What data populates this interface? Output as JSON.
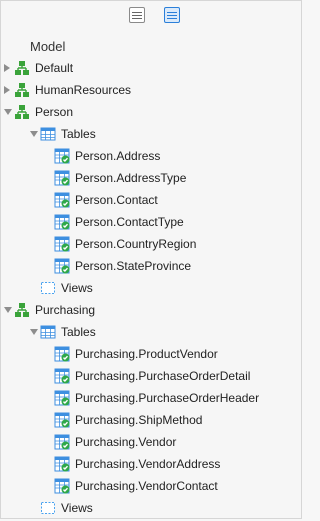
{
  "header": {
    "title": "Model"
  },
  "toolbar": {
    "buttons": [
      "view-toggle-a",
      "view-toggle-b"
    ]
  },
  "tree": {
    "schemas": [
      {
        "label": "Default",
        "expanded": false
      },
      {
        "label": "HumanResources",
        "expanded": false
      },
      {
        "label": "Person",
        "expanded": true,
        "tables_label": "Tables",
        "tables": [
          "Person.Address",
          "Person.AddressType",
          "Person.Contact",
          "Person.ContactType",
          "Person.CountryRegion",
          "Person.StateProvince"
        ],
        "views_label": "Views"
      },
      {
        "label": "Purchasing",
        "expanded": true,
        "tables_label": "Tables",
        "tables": [
          "Purchasing.ProductVendor",
          "Purchasing.PurchaseOrderDetail",
          "Purchasing.PurchaseOrderHeader",
          "Purchasing.ShipMethod",
          "Purchasing.Vendor",
          "Purchasing.VendorAddress",
          "Purchasing.VendorContact"
        ],
        "views_label": "Views"
      }
    ]
  },
  "colors": {
    "schema_green": "#3aa33a",
    "table_blue": "#3d8fe0",
    "check_green": "#2fa84a",
    "views_blue": "#4aa3f0"
  }
}
